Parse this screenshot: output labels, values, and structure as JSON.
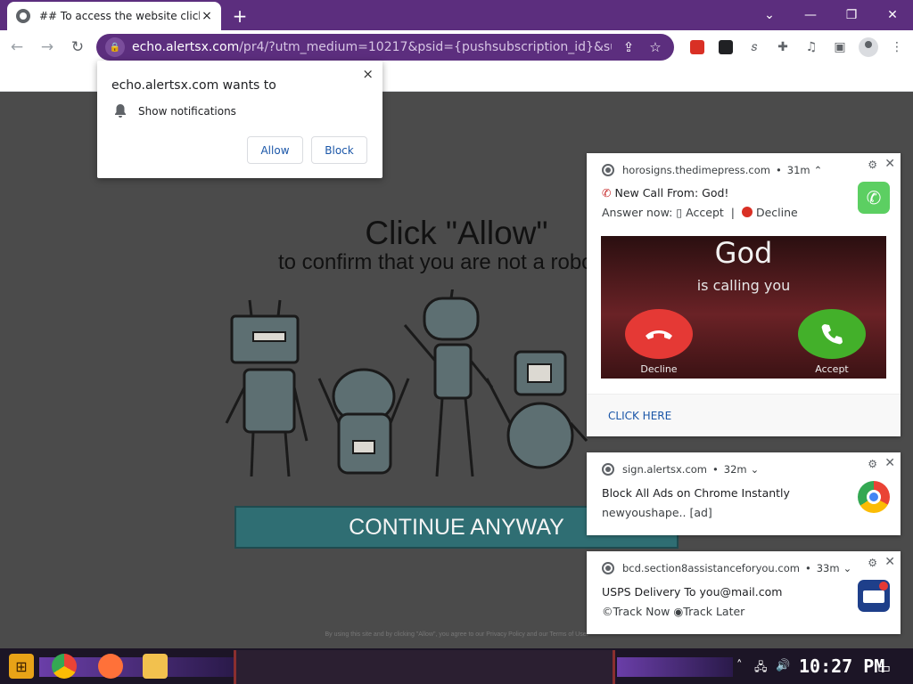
{
  "browser": {
    "tab_title": "## To access the website click",
    "tab_close": "×",
    "new_tab": "+",
    "window_controls": [
      "⌄",
      "—",
      "❐",
      "✕"
    ],
    "url_host": "echo.alertsx.com",
    "url_path": "/pr4/?utm_medium=10217&psid={pushsubscription_id}&sub3=htt...",
    "nav": {
      "back": "←",
      "forward": "→",
      "reload": "↻"
    }
  },
  "permission_prompt": {
    "title": "echo.alertsx.com wants to",
    "item": "Show notifications",
    "allow_label": "Allow",
    "block_label": "Block",
    "close": "×"
  },
  "page": {
    "headline": "Click \"Allow\"",
    "subline": "to confirm that you are not a robot",
    "continue_label": "CONTINUE ANYWAY",
    "disclaimer": "By using this site and by clicking \"Allow\", you agree to our Privacy Policy and our Terms of Use."
  },
  "notifications": [
    {
      "source": "horosigns.thedimepress.com",
      "age": "31m",
      "title": "New Call From: God!",
      "body_prefix": "Answer now: ",
      "accept": "Accept",
      "decline": "Decline",
      "image": {
        "name": "God",
        "subtitle": "is calling you",
        "decline": "Decline",
        "accept": "Accept"
      },
      "footer": "CLICK HERE",
      "icon_color": "#5ccf62"
    },
    {
      "source": "sign.alertsx.com",
      "age": "32m",
      "title": "Block All Ads on Chrome Instantly",
      "body": "newyoushape.. [ad]"
    },
    {
      "source": "bcd.section8assistanceforyou.com",
      "age": "33m",
      "title": "USPS Delivery To you@mail.com",
      "body": "©Track Now  ◉Track Later"
    }
  ],
  "taskbar": {
    "clock": "10:27 PM"
  },
  "colors": {
    "chrome_purple": "#5c2e7e",
    "page_bg": "#4b4b4b",
    "continue_bg": "#2f6e73",
    "link_blue": "#1a56a8"
  }
}
